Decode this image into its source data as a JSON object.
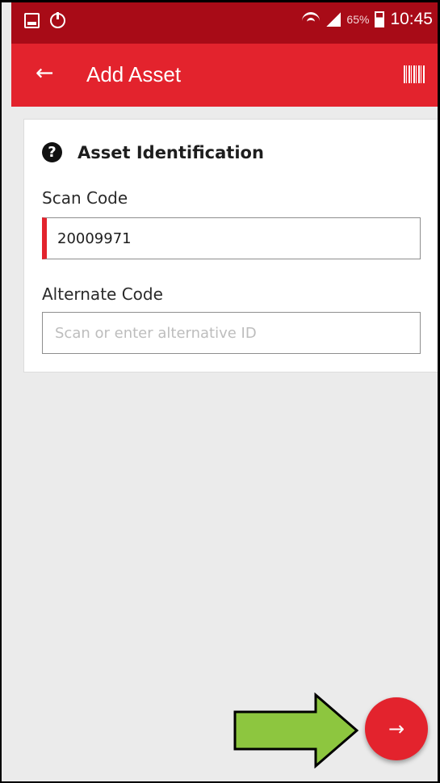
{
  "status_bar": {
    "battery_percent": "65%",
    "time": "10:45",
    "icons": [
      "gallery-icon",
      "power-icon",
      "wifi-icon",
      "signal-icon",
      "battery-charging-icon"
    ]
  },
  "app_bar": {
    "back_icon": "←",
    "title": "Add Asset",
    "barcode_icon_name": "barcode-icon"
  },
  "card": {
    "help_icon": "?",
    "section_title": "Asset Identification",
    "scan_code": {
      "label": "Scan Code",
      "value": "20009971"
    },
    "alternate_code": {
      "label": "Alternate Code",
      "placeholder": "Scan or enter alternative ID"
    }
  },
  "fab": {
    "icon": "→",
    "icon_name": "arrow-right-icon"
  },
  "colors": {
    "status_bar": "#a80b17",
    "app_bar": "#e3232d",
    "background": "#ebebeb",
    "input_accent": "#e3232d",
    "annotation_arrow": "#8dc63f"
  }
}
